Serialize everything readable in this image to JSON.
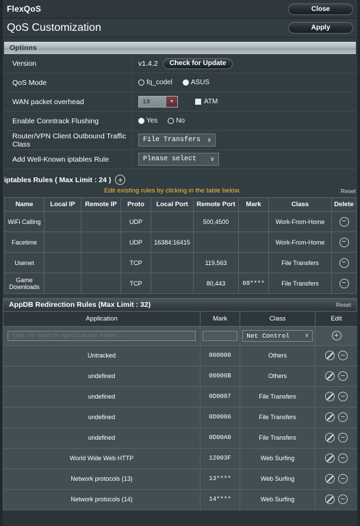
{
  "header": {
    "app_title": "FlexQoS",
    "close_label": "Close",
    "page_title": "QoS Customization",
    "apply_label": "Apply"
  },
  "options": {
    "section_label": "Options",
    "rows": {
      "version": {
        "label": "Version",
        "value": "v1.4.2",
        "check_update_label": "Check for Update"
      },
      "qos_mode": {
        "label": "QoS Mode",
        "option_a": "fq_codel",
        "option_a_selected": false,
        "option_b": "ASUS",
        "option_b_selected": true
      },
      "wan_overhead": {
        "label": "WAN packet overhead",
        "value": "18",
        "atm_label": "ATM",
        "atm_checked": false
      },
      "conntrack": {
        "label": "Enable Conntrack Flushing",
        "option_a": "Yes",
        "option_a_selected": true,
        "option_b": "No",
        "option_b_selected": false
      },
      "outbound_class": {
        "label": "Router/VPN Client Outbound Traffic Class",
        "value": "File Transfers"
      },
      "wellknown_rule": {
        "label": "Add Well-Known iptables Rule",
        "value": "Please select"
      }
    }
  },
  "iptables": {
    "section_label": "iptables Rules ( Max Limit : 24 )",
    "add_icon": "plus-circle-icon",
    "hint": "Edit existing rules by clicking in the table below.",
    "reset_label": "Reset",
    "columns": [
      "Name",
      "Local IP",
      "Remote IP",
      "Proto",
      "Local Port",
      "Remote Port",
      "Mark",
      "Class",
      "Delete"
    ],
    "rows": [
      {
        "name": "WiFi Calling",
        "local_ip": "",
        "remote_ip": "",
        "proto": "UDP",
        "local_port": "",
        "remote_port": "500,4500",
        "mark": "",
        "class": "Work-From-Home"
      },
      {
        "name": "Facetime",
        "local_ip": "",
        "remote_ip": "",
        "proto": "UDP",
        "local_port": "16384:16415",
        "remote_port": "",
        "mark": "",
        "class": "Work-From-Home"
      },
      {
        "name": "Usenet",
        "local_ip": "",
        "remote_ip": "",
        "proto": "TCP",
        "local_port": "",
        "remote_port": "119,563",
        "mark": "",
        "class": "File Transfers"
      },
      {
        "name": "Game Downloads",
        "local_ip": "",
        "remote_ip": "",
        "proto": "TCP",
        "local_port": "",
        "remote_port": "80,443",
        "mark": "08****",
        "class": "File Transfers"
      }
    ]
  },
  "appdb": {
    "section_label": "AppDB Redirection Rules (Max Limit : 32)",
    "reset_label": "Reset",
    "columns": [
      "Application",
      "Mark",
      "Class",
      "Edit"
    ],
    "input_row": {
      "search_placeholder": "Type to search application names...",
      "search_value": "",
      "mark_value": "",
      "class_value": "Net Control",
      "add_icon": "plus-circle-icon"
    },
    "rows": [
      {
        "application": "Untracked",
        "mark": "000000",
        "class": "Others"
      },
      {
        "application": "undefined",
        "mark": "00006B",
        "class": "Others"
      },
      {
        "application": "undefined",
        "mark": "0D0007",
        "class": "File Transfers"
      },
      {
        "application": "undefined",
        "mark": "0D0086",
        "class": "File Transfers"
      },
      {
        "application": "undefined",
        "mark": "0D00A0",
        "class": "File Transfers"
      },
      {
        "application": "World Wide Web HTTP",
        "mark": "12003F",
        "class": "Web Surfing"
      },
      {
        "application": "Network protocols (13)",
        "mark": "13****",
        "class": "Web Surfing"
      },
      {
        "application": "Network protocols (14)",
        "mark": "14****",
        "class": "Web Surfing"
      }
    ]
  },
  "icons": {
    "chevron_down": "∨",
    "minus": "−",
    "plus": "+",
    "triangle_down": "▼"
  }
}
